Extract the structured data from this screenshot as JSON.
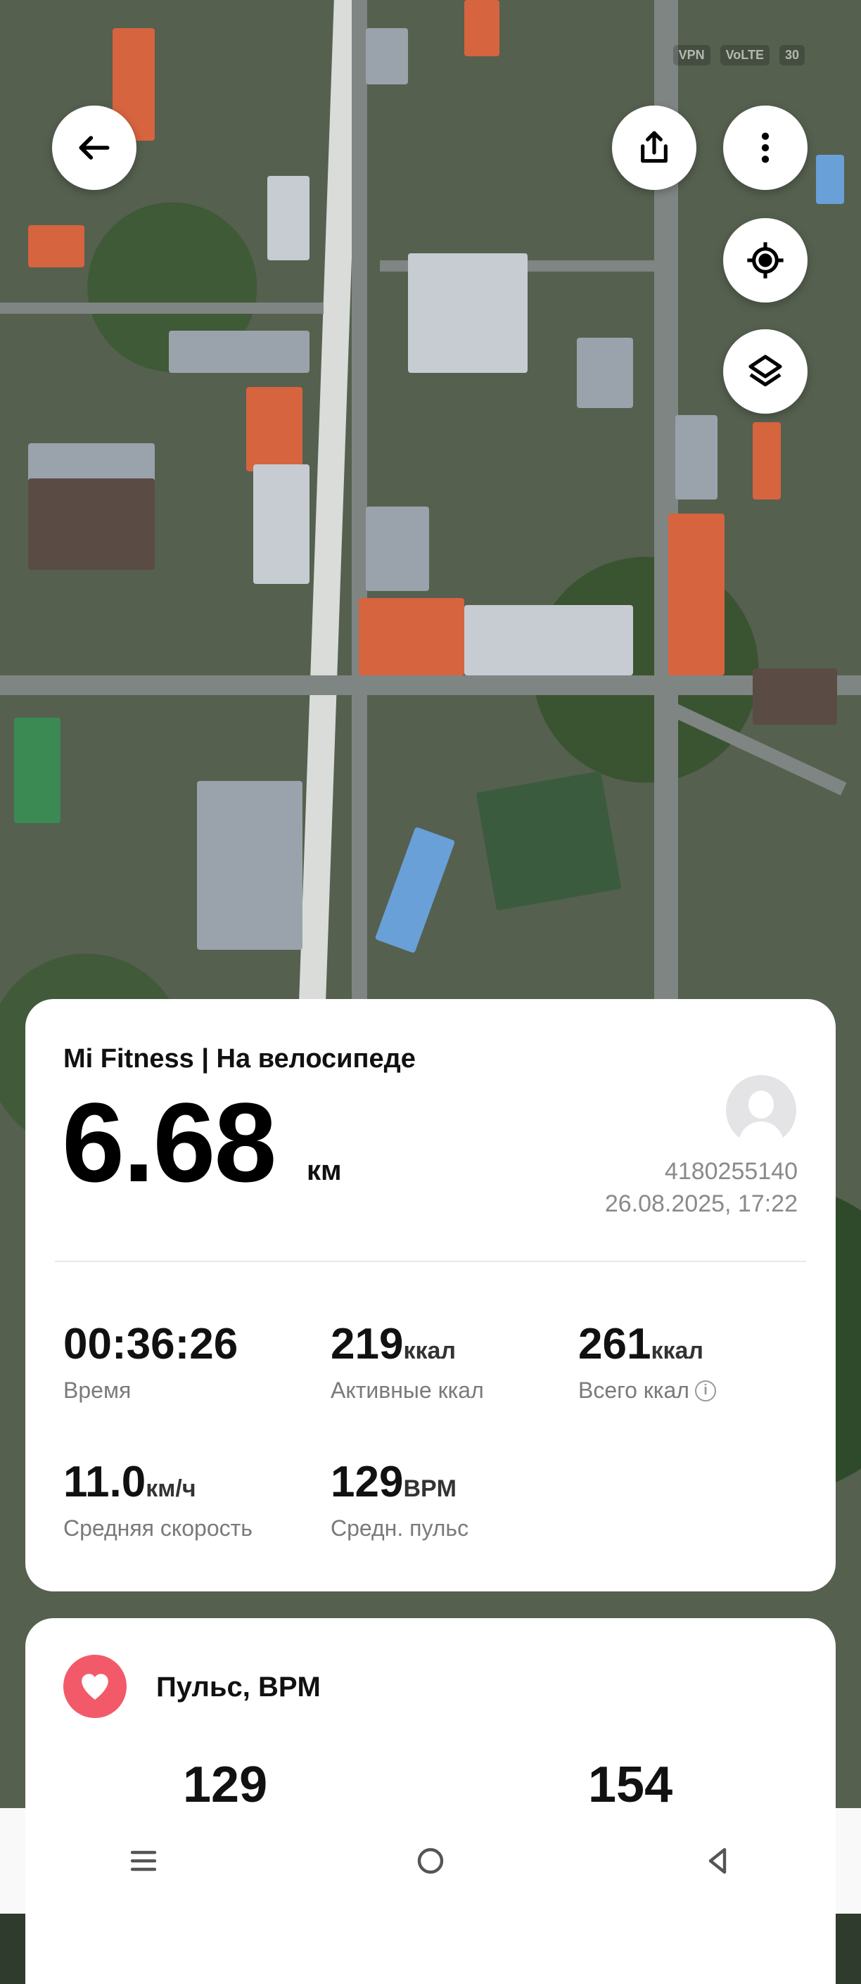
{
  "status": {
    "vpn": "VPN",
    "volte": "VoLTE",
    "battery": "30"
  },
  "workout": {
    "sport_title": "Mi Fitness | На велосипеде",
    "distance": "6.68",
    "distance_unit": "км",
    "user_id": "4180255140",
    "date": "26.08.2025, 17:22"
  },
  "stats": [
    {
      "value": "00:36:26",
      "unit": "",
      "label": "Время",
      "info": false
    },
    {
      "value": "219",
      "unit": "ккал",
      "label": "Активные ккал",
      "info": false
    },
    {
      "value": "261",
      "unit": "ккал",
      "label": "Всего ккал",
      "info": true
    },
    {
      "value": "11.0",
      "unit": "км/ч",
      "label": "Средняя скорость",
      "info": false
    },
    {
      "value": "129",
      "unit": "BPM",
      "label": "Средн. пульс",
      "info": false
    }
  ],
  "pulse": {
    "title": "Пульс, BPM",
    "avg": "129",
    "max": "154"
  },
  "icons": {
    "back": "arrow-left-icon",
    "share": "share-icon",
    "more": "more-vertical-icon",
    "locate": "locate-icon",
    "layers": "layers-icon",
    "heart": "heart-icon"
  },
  "colors": {
    "heart": "#f25a6a",
    "card": "#ffffff",
    "muted": "#8a8a8a"
  }
}
